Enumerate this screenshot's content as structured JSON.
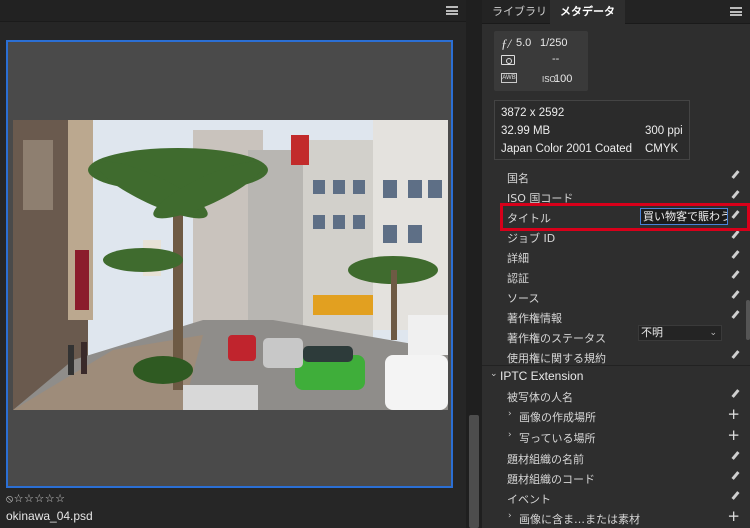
{
  "browser": {
    "filename": "okinawa_04.psd",
    "rating_glyphs": "⦸☆☆☆☆☆",
    "rating": 0,
    "selected": true,
    "menu_icon": "hamburger-menu-icon"
  },
  "panel": {
    "tabs": [
      {
        "label": "ライブラリ"
      },
      {
        "label": "メタデータ"
      }
    ],
    "active_tab": "メタデータ"
  },
  "camera": {
    "fnumber_icon": "ƒ/",
    "fnumber": "5.0",
    "shutter": "1/250",
    "exposure_comp": "--",
    "wb_icon": "AWB",
    "iso_label": "ISO",
    "iso": "100"
  },
  "file_info": {
    "dimensions": "3872 x 2592",
    "size": "32.99 MB",
    "resolution": "300 ppi",
    "color_profile": "Japan Color 2001 Coated",
    "color_mode": "CMYK"
  },
  "metadata": {
    "fields": [
      {
        "label": "国名"
      },
      {
        "label": "ISO 国コード"
      },
      {
        "label": "タイトル",
        "value": "買い物客で賑わう"
      },
      {
        "label": "ジョブ ID"
      },
      {
        "label": "詳細"
      },
      {
        "label": "認証"
      },
      {
        "label": "ソース"
      },
      {
        "label": "著作権情報"
      },
      {
        "label": "著作権のステータス",
        "value": "不明"
      },
      {
        "label": "使用権に関する規約"
      }
    ],
    "iptc_extension": {
      "title": "IPTC Extension",
      "fields": [
        {
          "label": "被写体の人名"
        },
        {
          "label": "画像の作成場所"
        },
        {
          "label": "写っている場所"
        },
        {
          "label": "題材組織の名前"
        },
        {
          "label": "題材組織のコード"
        },
        {
          "label": "イベント"
        },
        {
          "label": "画像に含ま…または素材"
        }
      ]
    }
  }
}
